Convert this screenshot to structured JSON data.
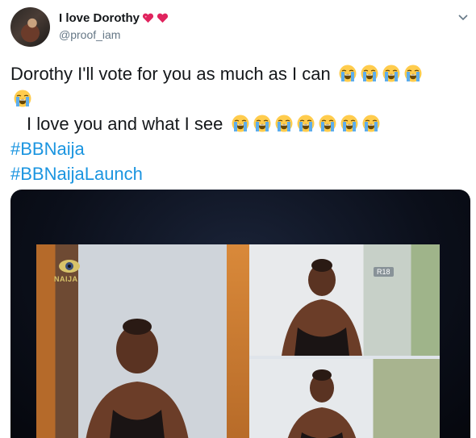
{
  "author": {
    "display_name": "I love Dorothy",
    "handle": "@proof_iam"
  },
  "tweet": {
    "line1": "Dorothy I'll vote for you as much as I can",
    "line2": "I love you and what I see",
    "hashtags": [
      "#BBNaija",
      "#BBNaijaLaunch"
    ],
    "emoji_line1": "loudly-crying-face x5",
    "emoji_line2": "loudly-crying-face x7"
  },
  "media": {
    "logo_text": "NAIJA",
    "rating_badge": "R18"
  },
  "icons": {
    "header_menu": "chevron-down-icon",
    "name_emoji": "two-hearts-icon"
  },
  "colors": {
    "hashtag": "#1b95e0",
    "handle": "#657786",
    "text": "#14171a",
    "heart": "#e0245e"
  }
}
